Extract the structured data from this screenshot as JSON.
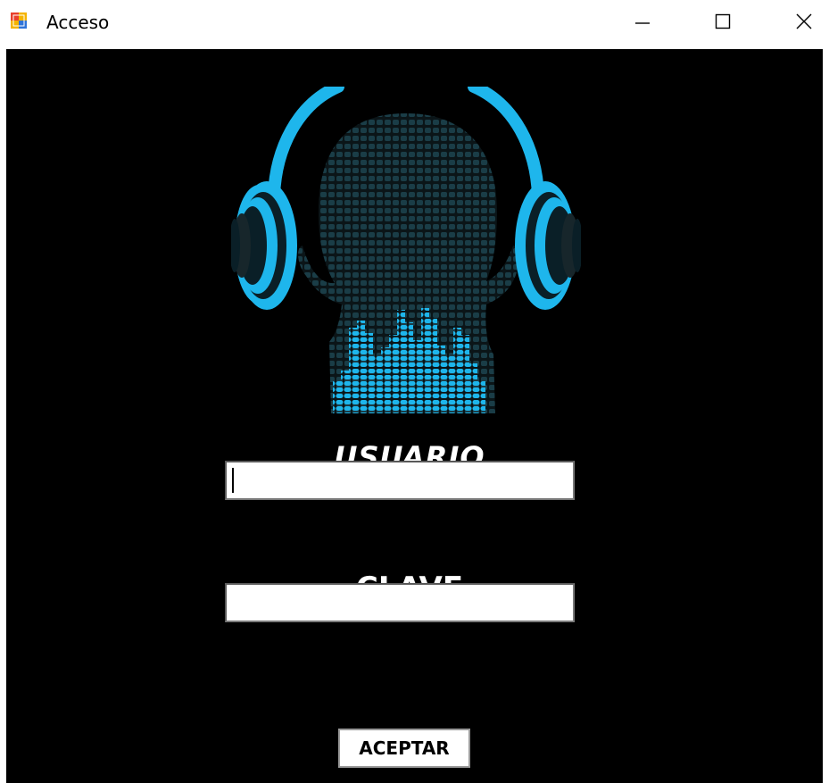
{
  "window": {
    "title": "Acceso",
    "app_icon": "windows-form-icon",
    "caption_buttons": [
      "minimize-icon",
      "maximize-icon",
      "close-icon"
    ]
  },
  "form": {
    "logo": "headphones-head-equalizer-logo",
    "username_label": "USUARIO",
    "username_value": "",
    "password_label": "CLAVE",
    "password_value": "",
    "submit_label": "ACEPTAR"
  },
  "colors": {
    "background": "#000000",
    "accent": "#1EB6EC",
    "head": "#14323C",
    "text": "#ffffff"
  }
}
